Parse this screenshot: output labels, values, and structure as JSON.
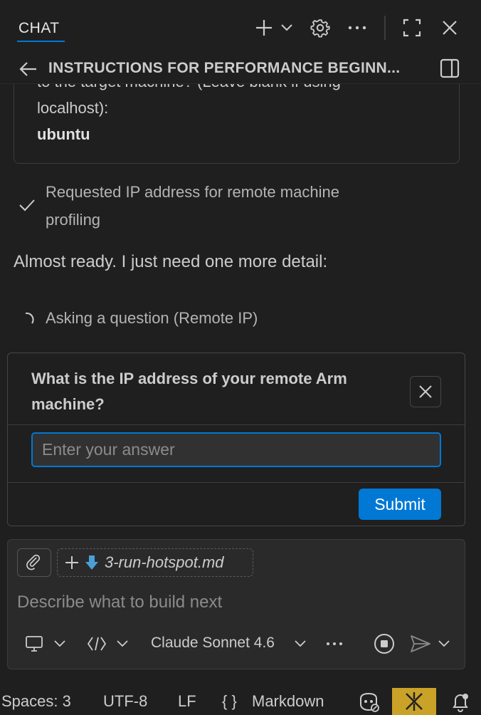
{
  "header": {
    "tab_label": "CHAT",
    "title": "INSTRUCTIONS FOR PERFORMANCE BEGINN..."
  },
  "transcript": {
    "card_lines": [
      "to the target machine? (Leave blank if using",
      "localhost):"
    ],
    "card_answer": "ubuntu",
    "completed_step": [
      "Requested IP address for remote machine",
      "profiling"
    ],
    "message": "Almost ready. I just need one more detail:",
    "in_progress_step": "Asking a question (Remote IP)"
  },
  "question": {
    "text": [
      "What is the IP address of your remote Arm",
      "machine?"
    ],
    "answer_placeholder": "Enter your answer",
    "submit_label": "Submit"
  },
  "composer": {
    "attached_file": "3-run-hotspot.md",
    "placeholder": "Describe what to build next",
    "model": "Claude Sonnet 4.6"
  },
  "statusbar": {
    "spaces": "Spaces: 3",
    "encoding": "UTF-8",
    "eol": "LF",
    "language_braces": "{ }",
    "language": "Markdown"
  },
  "colors": {
    "accent": "#0078d4",
    "status_active": "#c9a227",
    "background": "#1f1f1f"
  }
}
